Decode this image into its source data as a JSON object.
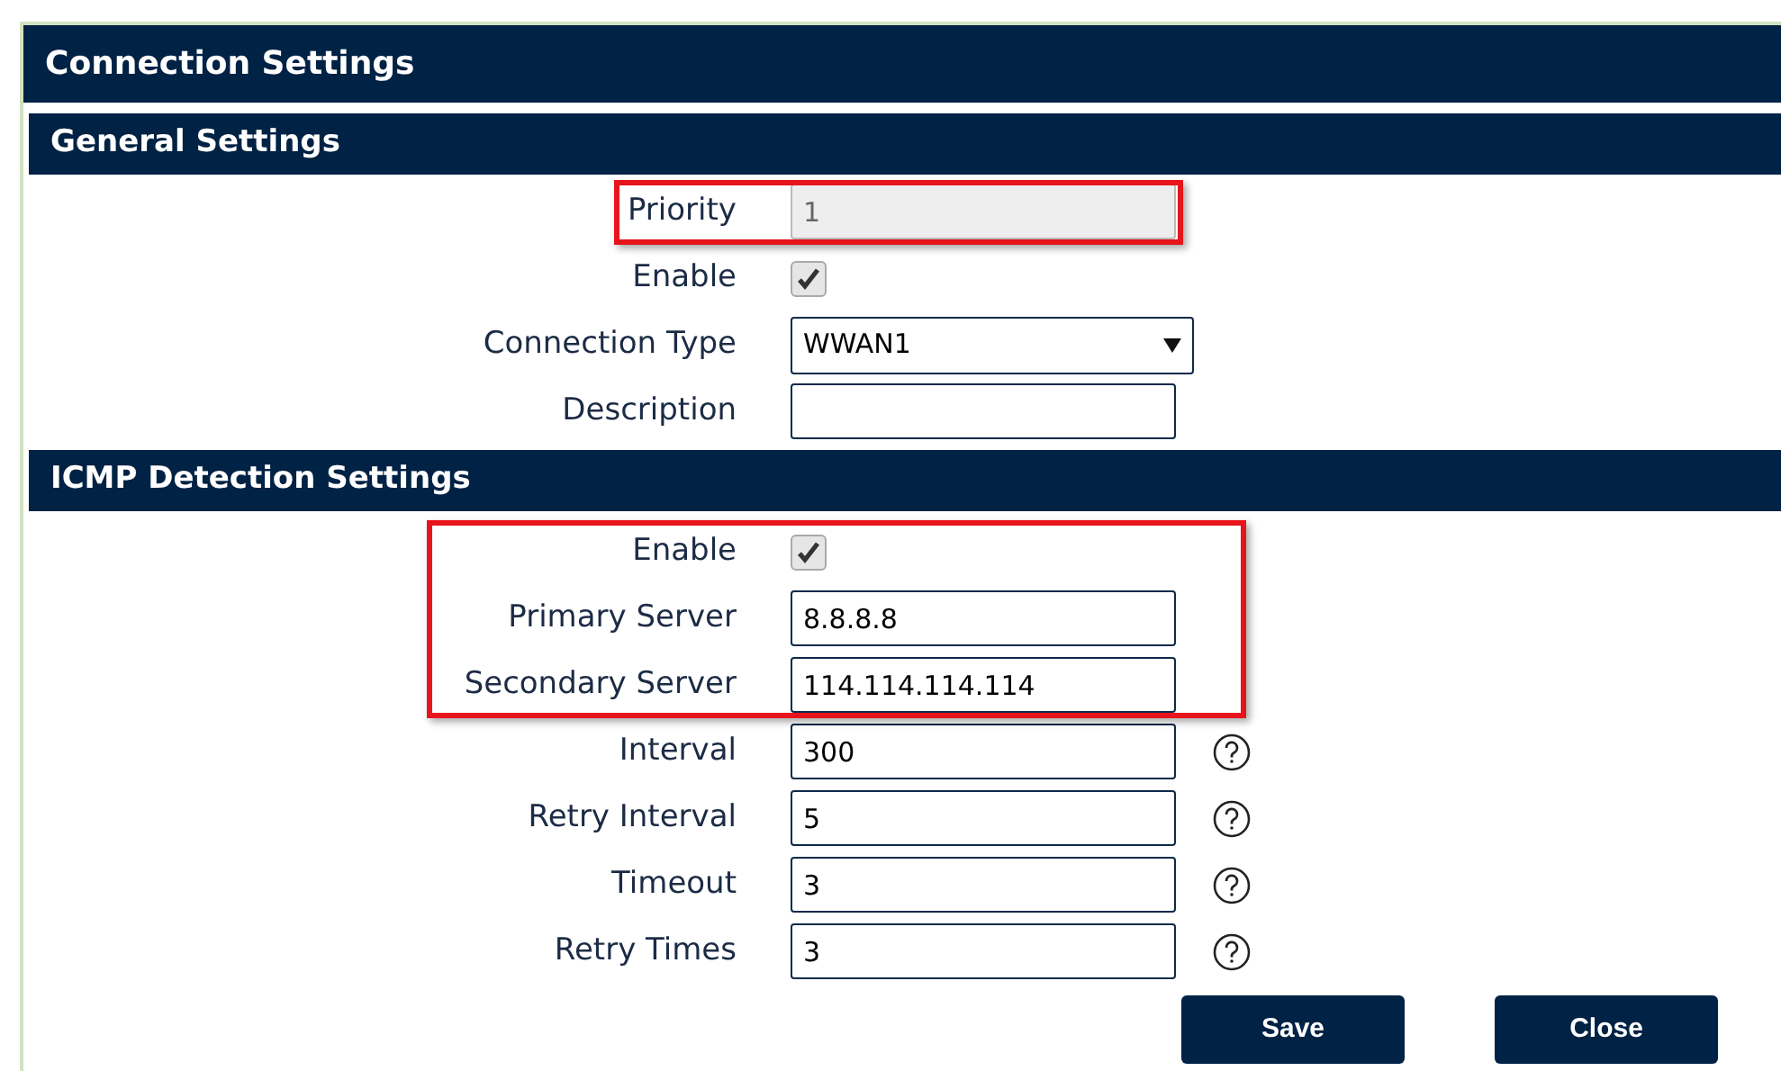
{
  "title": "Connection Settings",
  "sections": [
    {
      "title": "General Settings",
      "rows": [
        {
          "kind": "text",
          "label": "Priority",
          "value": "1",
          "disabled": true,
          "help": false,
          "highlighted": true
        },
        {
          "kind": "checkbox",
          "label": "Enable",
          "checked": true,
          "help": false,
          "highlighted": false
        },
        {
          "kind": "select",
          "label": "Connection Type",
          "value": "WWAN1",
          "help": false,
          "highlighted": false
        },
        {
          "kind": "text",
          "label": "Description",
          "value": "",
          "disabled": false,
          "help": false,
          "highlighted": false
        }
      ]
    },
    {
      "title": "ICMP Detection Settings",
      "rows": [
        {
          "kind": "checkbox",
          "label": "Enable",
          "checked": true,
          "help": false,
          "highlighted": true
        },
        {
          "kind": "text",
          "label": "Primary Server",
          "value": "8.8.8.8",
          "disabled": false,
          "help": false,
          "highlighted": true
        },
        {
          "kind": "text",
          "label": "Secondary Server",
          "value": "114.114.114.114",
          "disabled": false,
          "help": false,
          "highlighted": true
        },
        {
          "kind": "text",
          "label": "Interval",
          "value": "300",
          "disabled": false,
          "help": true,
          "highlighted": false
        },
        {
          "kind": "text",
          "label": "Retry Interval",
          "value": "5",
          "disabled": false,
          "help": true,
          "highlighted": false
        },
        {
          "kind": "text",
          "label": "Timeout",
          "value": "3",
          "disabled": false,
          "help": true,
          "highlighted": false
        },
        {
          "kind": "text",
          "label": "Retry Times",
          "value": "3",
          "disabled": false,
          "help": true,
          "highlighted": false
        }
      ]
    }
  ],
  "buttons": [
    "Save",
    "Close"
  ]
}
